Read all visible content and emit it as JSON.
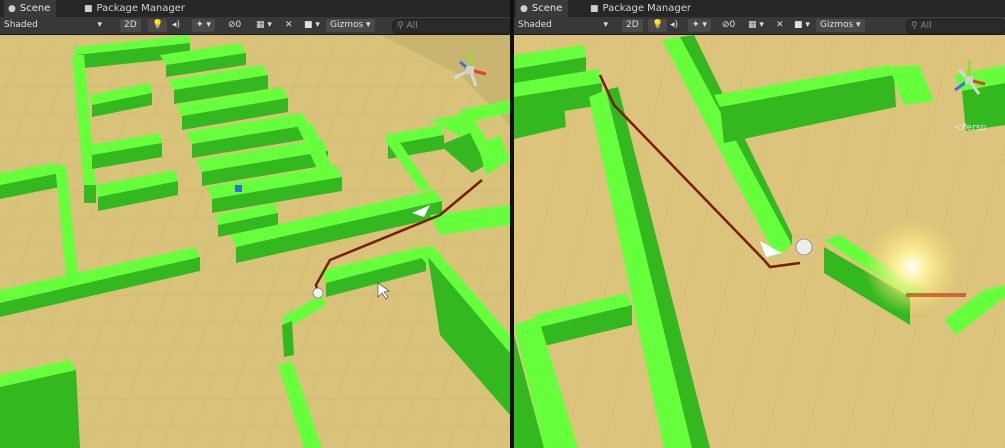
{
  "left_pane": {
    "tabs": [
      {
        "label": "Scene",
        "icon": "scene-icon"
      },
      {
        "label": "Package Manager",
        "icon": "package-icon"
      }
    ],
    "toolbar": {
      "shading_mode": "Shaded",
      "mode_2d": "2D",
      "gizmos": "Gizmos",
      "search_placeholder": "All"
    }
  },
  "right_pane": {
    "tabs": [
      {
        "label": "Scene",
        "icon": "scene-icon"
      },
      {
        "label": "Package Manager",
        "icon": "package-icon"
      }
    ],
    "toolbar": {
      "shading_mode": "Shaded",
      "mode_2d": "2D",
      "gizmos": "Gizmos",
      "search_placeholder": "All"
    },
    "projection_label": "Persp"
  },
  "colors": {
    "floor": "#d9c27a",
    "wall_top": "#66ff3c",
    "wall_side": "#34b81f",
    "path": "#7a1e0e"
  }
}
